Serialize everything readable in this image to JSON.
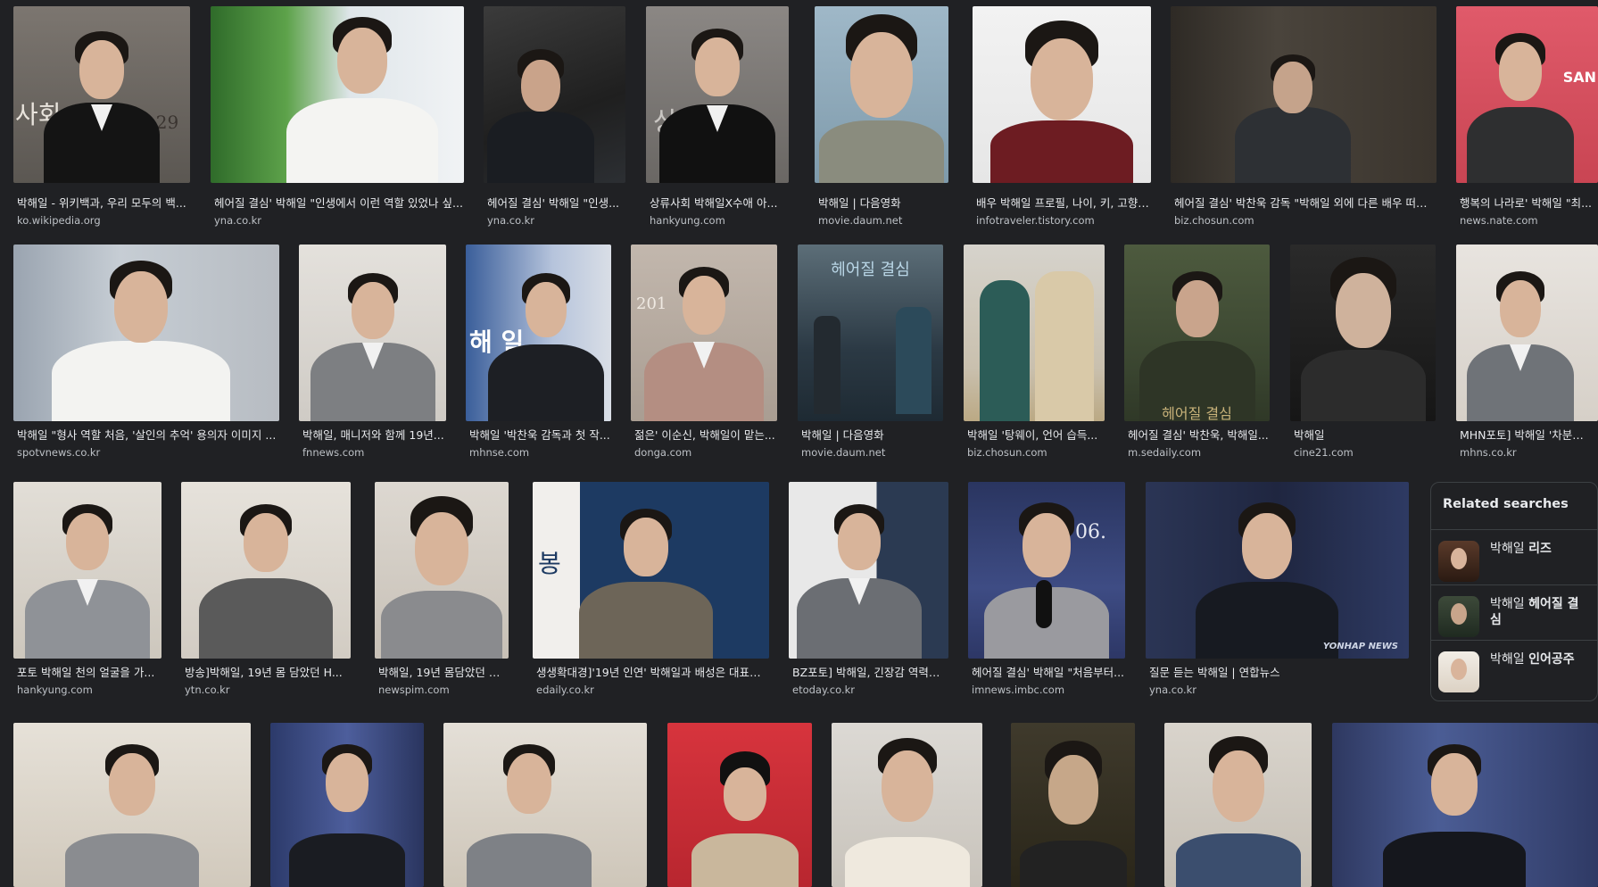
{
  "results": [
    {
      "title": "박해일 - 위키백과, 우리 모두의 백...",
      "source": "ko.wikipedia.org"
    },
    {
      "title": "헤어질 결심' 박해일 \"인생에서 이런 역할 있었나 싶...",
      "source": "yna.co.kr"
    },
    {
      "title": "헤어질 결심' 박해일 \"인생...",
      "source": "yna.co.kr"
    },
    {
      "title": "상류사회 박해일X수애 아...",
      "source": "hankyung.com"
    },
    {
      "title": "박해일 | 다음영화",
      "source": "movie.daum.net"
    },
    {
      "title": "배우 박해일 프로필, 나이, 키, 고향, ...",
      "source": "infotraveler.tistory.com"
    },
    {
      "title": "헤어질 결심' 박찬욱 감독 \"박해일 외에 다른 배우 떠오...",
      "source": "biz.chosun.com"
    },
    {
      "title": "행복의 나라로' 박해일 \"최...",
      "source": "news.nate.com"
    },
    {
      "title": "박해일 \"형사 역할 처음, '살인의 추억' 용의자 이미지 ...",
      "source": "spotvnews.co.kr"
    },
    {
      "title": "박해일, 매니저와 함께 19년...",
      "source": "fnnews.com"
    },
    {
      "title": "박해일 '박찬욱 감독과 첫 작...",
      "source": "mhnse.com"
    },
    {
      "title": "젊은' 이순신, 박해일이 맡는...",
      "source": "donga.com"
    },
    {
      "title": "박해일 | 다음영화",
      "source": "movie.daum.net"
    },
    {
      "title": "박해일 '탕웨이, 언어 습득...",
      "source": "biz.chosun.com"
    },
    {
      "title": "헤어질 결심' 박찬욱, 박해일...",
      "source": "m.sedaily.com"
    },
    {
      "title": "박해일",
      "source": "cine21.com"
    },
    {
      "title": "MHN포토] 박해일 '차분한 ...",
      "source": "mhns.co.kr"
    },
    {
      "title": "포토 박해일 천의 얼굴을 가...",
      "source": "hankyung.com"
    },
    {
      "title": "방송]박해일, 19년 몸 담았던 H...",
      "source": "ytn.co.kr"
    },
    {
      "title": "박해일, 19년 몸담았던 소...",
      "source": "newspim.com"
    },
    {
      "title": "생생확대경]'19년 인연' 박해일과 배성은 대표의...",
      "source": "edaily.co.kr"
    },
    {
      "title": "BZ포토] 박해일, 긴장감 역력한...",
      "source": "etoday.co.kr"
    },
    {
      "title": "헤어질 결심' 박해일 \"처음부터...",
      "source": "imnews.imbc.com"
    },
    {
      "title": "질문 듣는 박해일 | 연합뉴스",
      "source": "yna.co.kr"
    }
  ],
  "overlay_text": {
    "r1c1_date": "08.29",
    "r1c1_sign": "사회",
    "r1c4_sign": "상류사회",
    "r1c8_sign": "SAN",
    "r2c3_sign": "해 일",
    "r2c4_year": "201",
    "r2c5_poster": "헤어질 결심",
    "r2c7_poster": "헤어질 결심",
    "r3c4_sign": "봉",
    "r3c6_date": "06.",
    "r3c7_watermark": "YONHAP NEWS"
  },
  "related": {
    "heading": "Related searches",
    "items": [
      {
        "prefix": "박해일 ",
        "bold": "리즈"
      },
      {
        "prefix": "박해일 ",
        "bold": "헤어질 결심"
      },
      {
        "prefix": "박해일 ",
        "bold": "인어공주"
      }
    ]
  },
  "colors": {
    "page_bg": "#202124",
    "title_text": "#e8eaed",
    "source_text": "#bdc1c6",
    "panel_border": "#3c4043"
  }
}
